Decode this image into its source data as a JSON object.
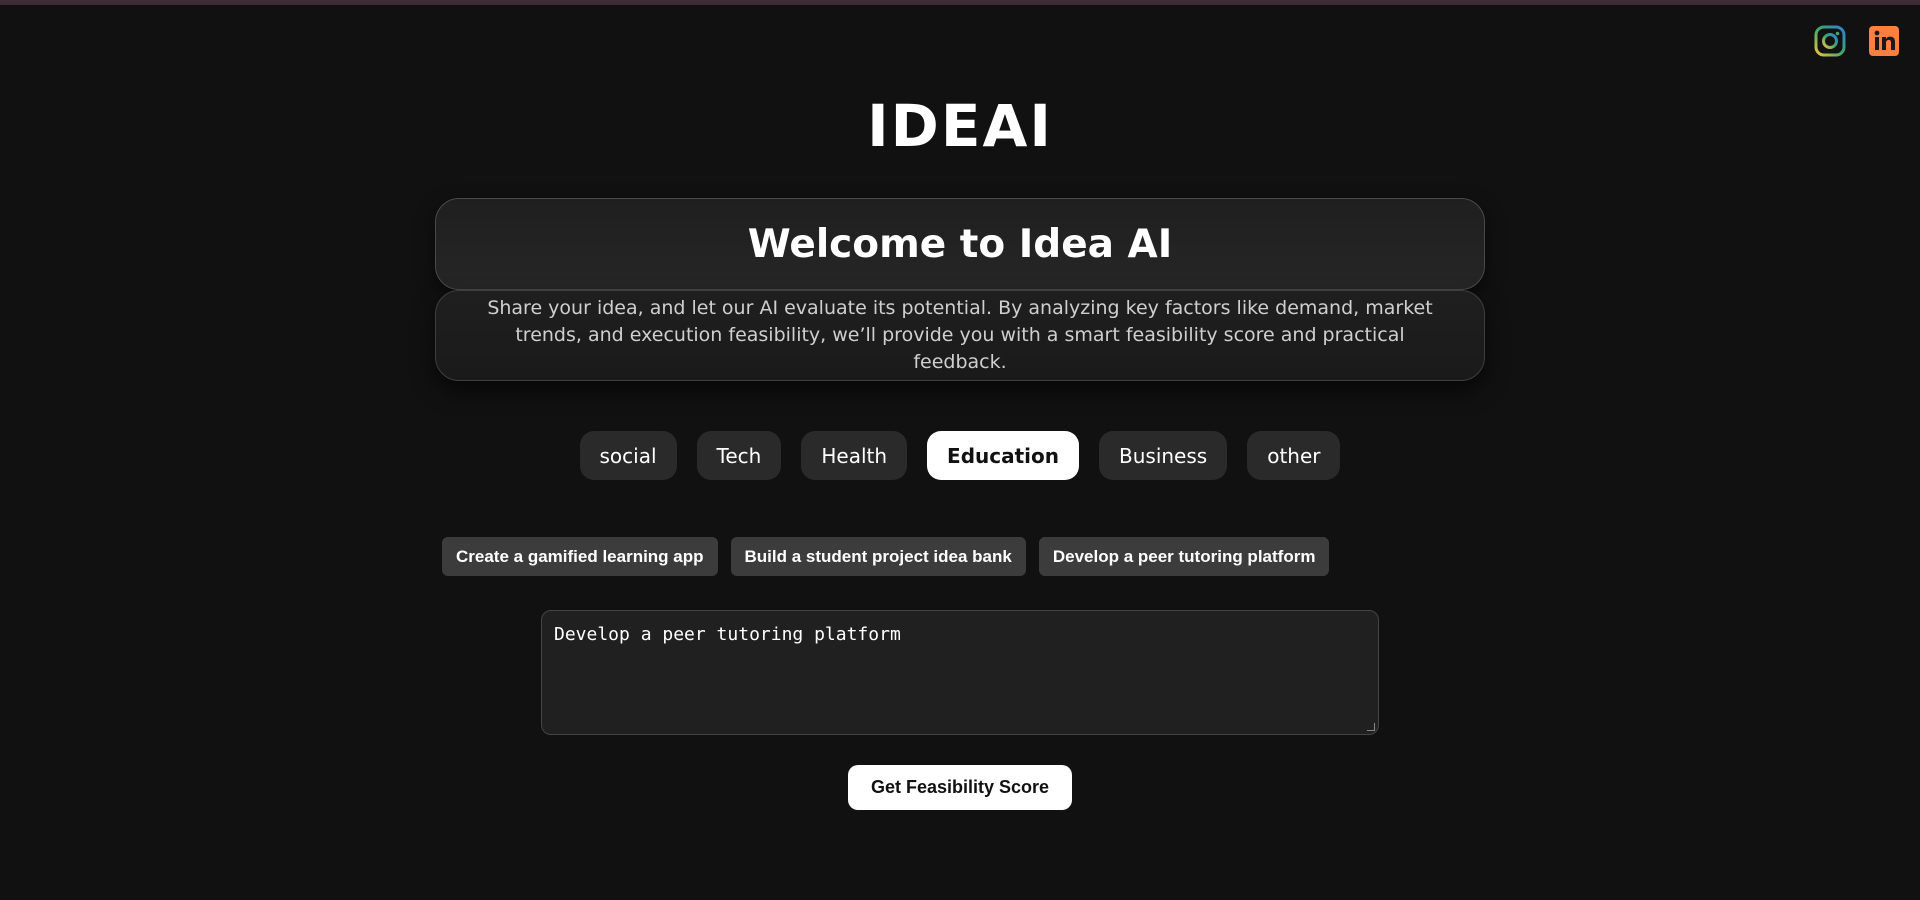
{
  "header": {
    "brand": "IDEAI",
    "social": [
      {
        "icon": "instagram-icon",
        "color": "#3ba776"
      },
      {
        "icon": "linkedin-icon",
        "color": "#ff7f3f"
      }
    ]
  },
  "hero": {
    "title": "Welcome to Idea AI",
    "description": "Share your idea, and let our AI evaluate its potential. By analyzing key factors like demand, market trends, and execution feasibility, we’ll provide you with a smart feasibility score and practical feedback."
  },
  "categories": {
    "items": [
      "social",
      "Tech",
      "Health",
      "Education",
      "Business",
      "other"
    ],
    "active": "Education"
  },
  "suggestions": [
    "Create a gamified learning app",
    "Build a student project idea bank",
    "Develop a peer tutoring platform"
  ],
  "input": {
    "value": "Develop a peer tutoring platform"
  },
  "submit_label": "Get Feasibility Score",
  "colors": {
    "background": "#111112",
    "panel": "#1f1f1f",
    "chip": "#2a2a2a",
    "suggestion_chip": "#3c3c3c",
    "active_chip": "#ffffff"
  }
}
